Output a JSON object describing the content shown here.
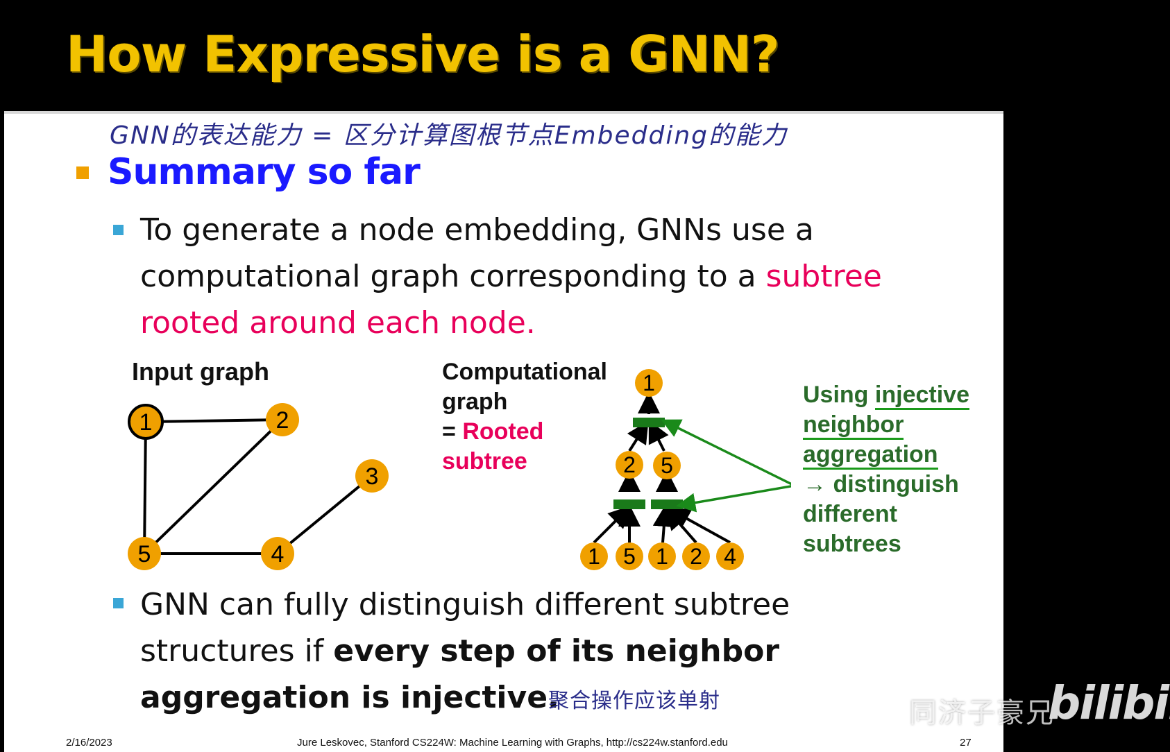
{
  "slide": {
    "title": "How Expressive is a GNN?",
    "handwritten_note_top": "GNN的表达能力 = 区分计算图根节点Embedding的能力",
    "heading": "Summary so far",
    "bullet1": {
      "text_before": "To generate a node embedding, GNNs use a computational graph corresponding to a ",
      "highlight": "subtree rooted around each node."
    },
    "input_graph_label": "Input graph",
    "computational_label": {
      "line1": "Computational",
      "line2": "graph",
      "eq": "= ",
      "rooted": "Rooted",
      "subtree": "subtree"
    },
    "green_note": {
      "using": "Using ",
      "injective": "injective",
      "neighbor": "neighbor",
      "aggregation": "aggregation",
      "arrow_text": "→ distinguish",
      "different": "different",
      "subtrees": "subtrees"
    },
    "bullet2": {
      "plain": "GNN can fully distinguish different subtree structures if ",
      "bold": "every step of its neighbor aggregation is injective."
    },
    "handwritten_note_bottom": "聚合操作应该单射",
    "input_graph": {
      "nodes": [
        {
          "id": "1"
        },
        {
          "id": "2"
        },
        {
          "id": "3"
        },
        {
          "id": "4"
        },
        {
          "id": "5"
        }
      ],
      "edges": [
        [
          "1",
          "2"
        ],
        [
          "1",
          "5"
        ],
        [
          "2",
          "5"
        ],
        [
          "5",
          "4"
        ],
        [
          "4",
          "3"
        ]
      ]
    },
    "tree": {
      "root": "1",
      "level2": [
        "2",
        "5"
      ],
      "leaves": [
        "1",
        "5",
        "1",
        "2",
        "4"
      ]
    }
  },
  "footer": {
    "date": "2/16/2023",
    "credit": "Jure Leskovec, Stanford CS224W: Machine Learning with Graphs, http://cs224w.stanford.edu",
    "page": "27"
  },
  "watermark": {
    "uploader": "同济子豪兄",
    "logo": "bilibili"
  },
  "colors": {
    "title": "#f2c200",
    "heading": "#1a1aff",
    "highlight": "#e8005a",
    "node": "#f0a000",
    "aggregator": "#1a7a1a",
    "note": "#2a6b2a"
  }
}
